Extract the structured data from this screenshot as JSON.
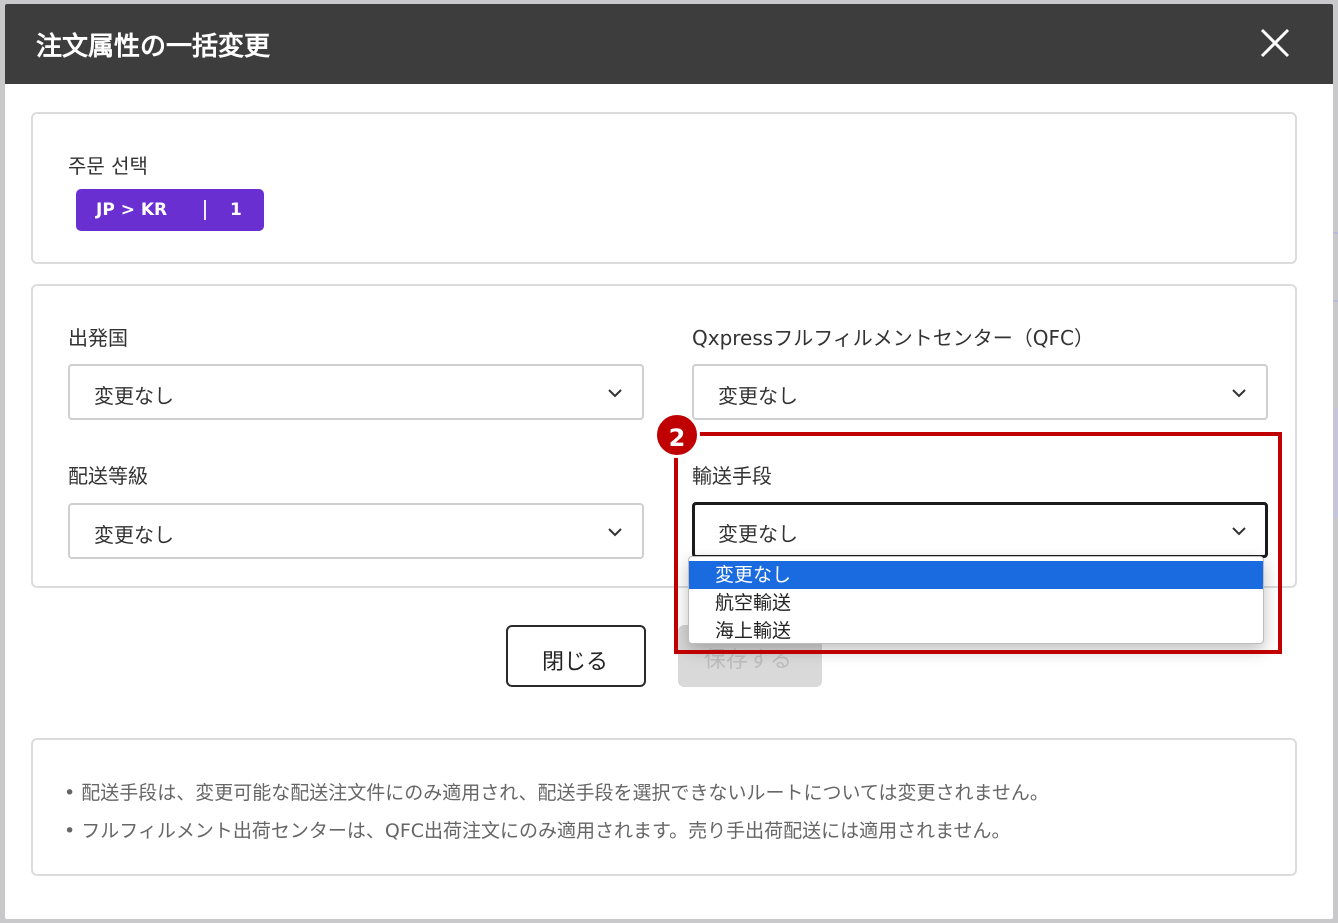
{
  "modal": {
    "title": "注文属性の一括変更"
  },
  "order_select": {
    "label": "주문 선택",
    "chip_route": "JP > KR",
    "chip_count": "1"
  },
  "fields": {
    "origin": {
      "label": "出発国",
      "value": "変更なし"
    },
    "qfc": {
      "label": "Qxpressフルフィルメントセンター（QFC）",
      "value": "変更なし"
    },
    "shipping_grade": {
      "label": "配送等級",
      "value": "変更なし"
    },
    "transport": {
      "label": "輸送手段",
      "value": "変更なし"
    }
  },
  "dropdown": {
    "options": [
      "変更なし",
      "航空輸送",
      "海上輸送"
    ],
    "selected_index": 0
  },
  "buttons": {
    "close_label": "閉じる",
    "save_label": "保存する"
  },
  "annotation": {
    "step": "2",
    "color": "#c00000"
  },
  "notes": [
    "• 配送手段は、変更可能な配送注文件にのみ適用され、配送手段を選択できないルートについては変更されません。",
    "• フルフィルメント出荷センターは、QFC出荷注文にのみ適用されます。売り手出荷配送には適用されません。"
  ],
  "colors": {
    "header": "#3d3d3d",
    "chip": "#6a2fd0",
    "dropdown_selected": "#1a6ae0"
  }
}
